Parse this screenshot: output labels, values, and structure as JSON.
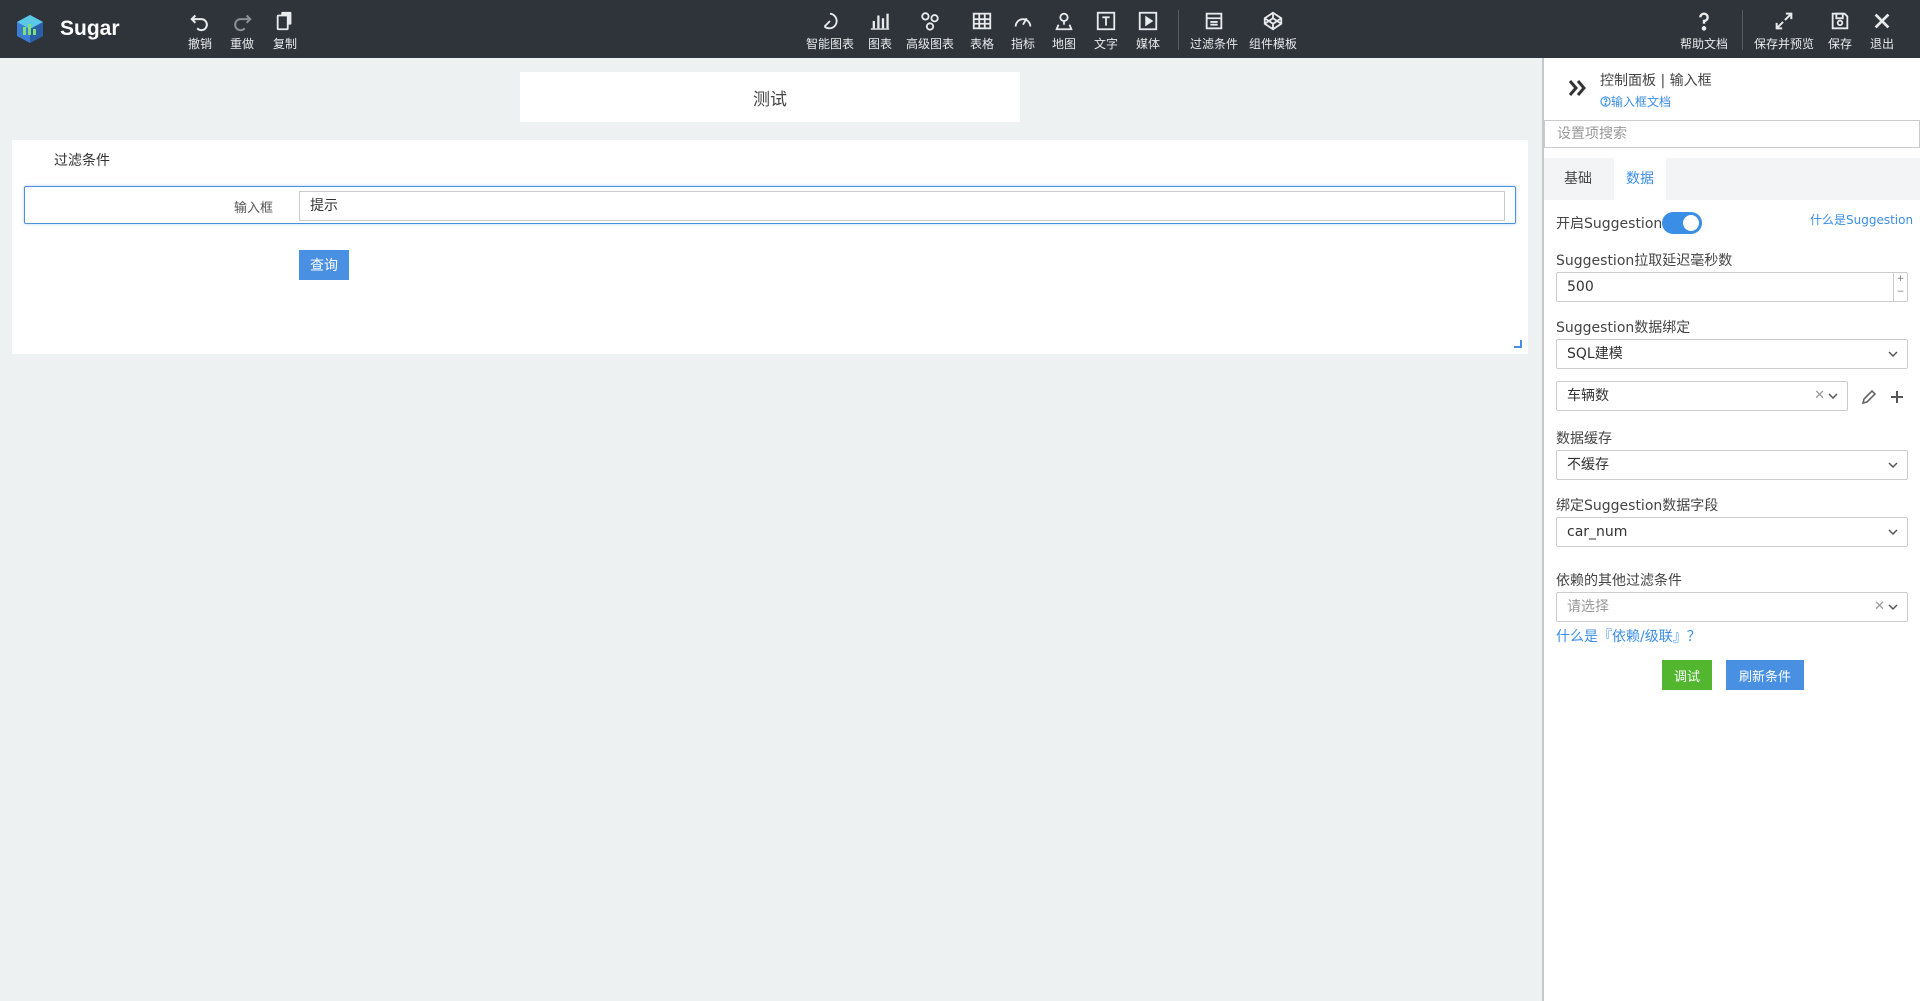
{
  "app": {
    "name": "Sugar"
  },
  "toolbar": {
    "undo": "撤销",
    "redo": "重做",
    "copy": "复制",
    "smart_chart": "智能图表",
    "chart": "图表",
    "advanced_chart": "高级图表",
    "table": "表格",
    "indicator": "指标",
    "map": "地图",
    "text": "文字",
    "media": "媒体",
    "filter": "过滤条件",
    "component_template": "组件模板",
    "help_doc": "帮助文档",
    "save_preview": "保存并预览",
    "save": "保存",
    "exit": "退出"
  },
  "canvas": {
    "title": "测试",
    "filter_title": "过滤条件",
    "input_label": "输入框",
    "input_value": "提示",
    "query_button": "查询"
  },
  "panel": {
    "title": "控制面板 | 输入框",
    "doc_link": "输入框文档",
    "search_placeholder": "设置项搜索",
    "tabs": [
      "基础",
      "数据"
    ],
    "active_tab": "数据",
    "enable_suggestion": "开启Suggestion",
    "enable_suggestion_on": true,
    "what_is_suggestion": "什么是Suggestion",
    "delay_label": "Suggestion拉取延迟毫秒数",
    "delay_value": "500",
    "binding_label": "Suggestion数据绑定",
    "binding_value": "SQL建模",
    "model_value": "车辆数",
    "cache_label": "数据缓存",
    "cache_value": "不缓存",
    "field_label": "绑定Suggestion数据字段",
    "field_value": "car_num",
    "depend_label": "依赖的其他过滤条件",
    "depend_placeholder": "请选择",
    "depend_link": "什么是『依赖/级联』？",
    "debug_button": "调试",
    "refresh_button": "刷新条件",
    "colors": {
      "accent": "#3a8ee6",
      "success": "#52b72f",
      "toolbar": "#2f343a"
    }
  }
}
